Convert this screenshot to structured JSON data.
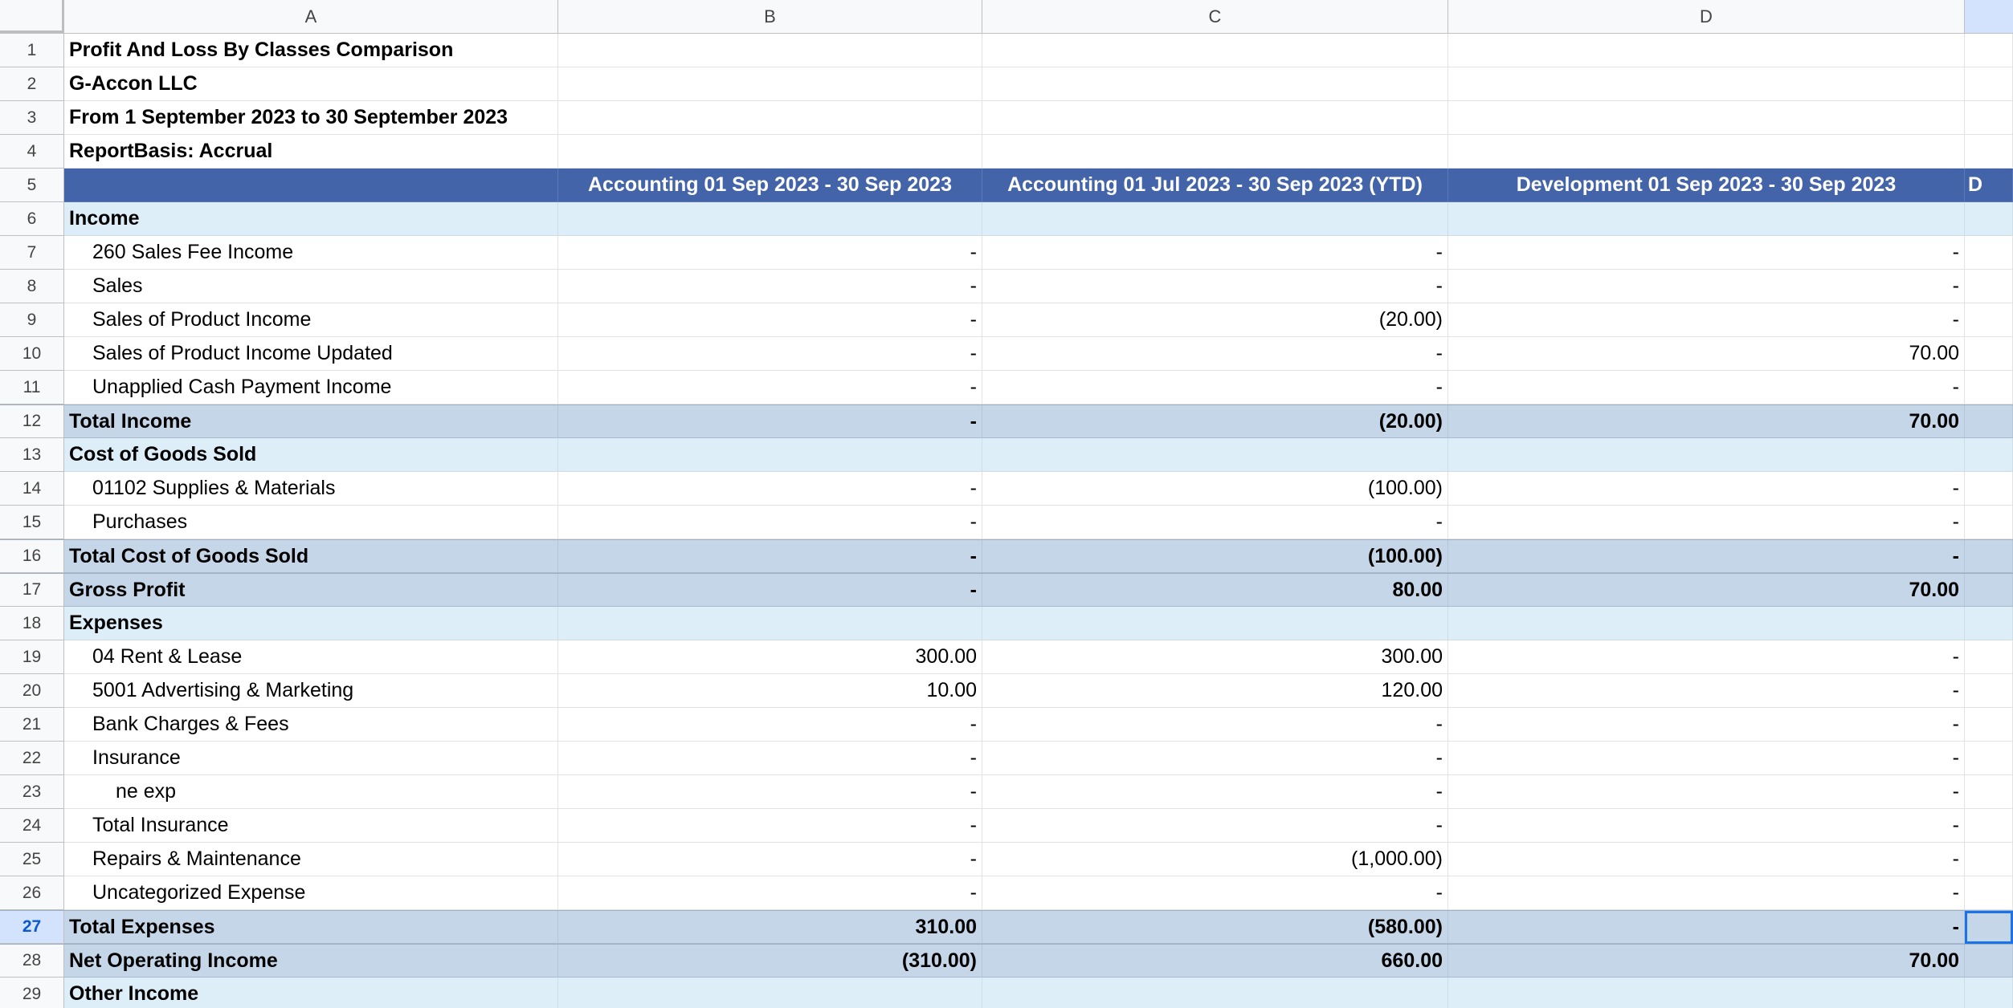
{
  "columns": [
    "A",
    "B",
    "C",
    "D"
  ],
  "rows": [
    {
      "n": "1",
      "type": "title",
      "a": "Profit And Loss By Classes Comparison",
      "b": "",
      "c": "",
      "d": "",
      "e": ""
    },
    {
      "n": "2",
      "type": "title",
      "a": "G-Accon LLC",
      "b": "",
      "c": "",
      "d": "",
      "e": ""
    },
    {
      "n": "3",
      "type": "title",
      "a": "From 1 September 2023 to 30 September 2023",
      "b": "",
      "c": "",
      "d": "",
      "e": ""
    },
    {
      "n": "4",
      "type": "title",
      "a": "ReportBasis: Accrual",
      "b": "",
      "c": "",
      "d": "",
      "e": ""
    },
    {
      "n": "5",
      "type": "header",
      "a": "",
      "b": "Accounting 01 Sep 2023 - 30 Sep 2023",
      "c": "Accounting 01 Jul 2023 - 30 Sep 2023 (YTD)",
      "d": "Development 01 Sep 2023 - 30 Sep 2023",
      "e": "D"
    },
    {
      "n": "6",
      "type": "section",
      "a": "Income",
      "b": "",
      "c": "",
      "d": "",
      "e": ""
    },
    {
      "n": "7",
      "type": "line",
      "a": "260 Sales Fee Income",
      "b": "-",
      "c": "-",
      "d": "-",
      "e": ""
    },
    {
      "n": "8",
      "type": "line",
      "a": "Sales",
      "b": "-",
      "c": "-",
      "d": "-",
      "e": ""
    },
    {
      "n": "9",
      "type": "line",
      "a": "Sales of Product Income",
      "b": "-",
      "c": "(20.00)",
      "d": "-",
      "e": ""
    },
    {
      "n": "10",
      "type": "line",
      "a": "Sales of Product Income Updated",
      "b": "-",
      "c": "-",
      "d": "70.00",
      "e": ""
    },
    {
      "n": "11",
      "type": "line",
      "a": "Unapplied Cash Payment Income",
      "b": "-",
      "c": "-",
      "d": "-",
      "e": ""
    },
    {
      "n": "12",
      "type": "total",
      "a": "Total Income",
      "b": "-",
      "c": "(20.00)",
      "d": "70.00",
      "e": ""
    },
    {
      "n": "13",
      "type": "section",
      "a": "Cost of Goods Sold",
      "b": "",
      "c": "",
      "d": "",
      "e": ""
    },
    {
      "n": "14",
      "type": "line",
      "a": "01102 Supplies & Materials",
      "b": "-",
      "c": "(100.00)",
      "d": "-",
      "e": ""
    },
    {
      "n": "15",
      "type": "line",
      "a": "Purchases",
      "b": "-",
      "c": "-",
      "d": "-",
      "e": ""
    },
    {
      "n": "16",
      "type": "total",
      "a": "Total Cost of Goods Sold",
      "b": "-",
      "c": "(100.00)",
      "d": "-",
      "e": ""
    },
    {
      "n": "17",
      "type": "total",
      "a": "Gross Profit",
      "b": "-",
      "c": "80.00",
      "d": "70.00",
      "e": ""
    },
    {
      "n": "18",
      "type": "section",
      "a": "Expenses",
      "b": "",
      "c": "",
      "d": "",
      "e": ""
    },
    {
      "n": "19",
      "type": "line",
      "a": "04 Rent & Lease",
      "b": "300.00",
      "c": "300.00",
      "d": "-",
      "e": ""
    },
    {
      "n": "20",
      "type": "line",
      "a": "5001 Advertising & Marketing",
      "b": "10.00",
      "c": "120.00",
      "d": "-",
      "e": ""
    },
    {
      "n": "21",
      "type": "line",
      "a": "Bank Charges & Fees",
      "b": "-",
      "c": "-",
      "d": "-",
      "e": ""
    },
    {
      "n": "22",
      "type": "line",
      "a": "Insurance",
      "b": "-",
      "c": "-",
      "d": "-",
      "e": ""
    },
    {
      "n": "23",
      "type": "subline",
      "a": "ne exp",
      "b": "-",
      "c": "-",
      "d": "-",
      "e": ""
    },
    {
      "n": "24",
      "type": "line",
      "a": "Total Insurance",
      "b": "-",
      "c": "-",
      "d": "-",
      "e": ""
    },
    {
      "n": "25",
      "type": "line",
      "a": "Repairs & Maintenance",
      "b": "-",
      "c": "(1,000.00)",
      "d": "-",
      "e": ""
    },
    {
      "n": "26",
      "type": "line",
      "a": "Uncategorized Expense",
      "b": "-",
      "c": "-",
      "d": "-",
      "e": ""
    },
    {
      "n": "27",
      "type": "total",
      "active": true,
      "a": "Total Expenses",
      "b": "310.00",
      "c": "(580.00)",
      "d": "-",
      "e": ""
    },
    {
      "n": "28",
      "type": "total",
      "a": "Net Operating Income",
      "b": "(310.00)",
      "c": "660.00",
      "d": "70.00",
      "e": ""
    },
    {
      "n": "29",
      "type": "section",
      "a": "Other Income",
      "b": "",
      "c": "",
      "d": "",
      "e": ""
    }
  ]
}
